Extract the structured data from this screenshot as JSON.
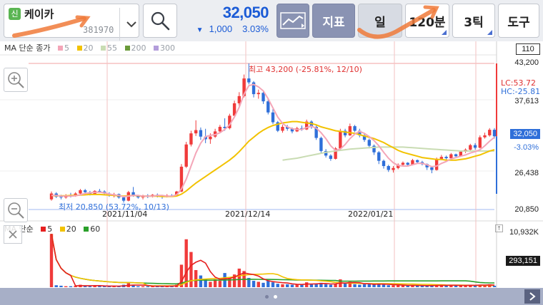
{
  "stock": {
    "badge": "신",
    "name": "케이카",
    "code": "381970"
  },
  "quote": {
    "price": "32,050",
    "direction": "▼",
    "change": "1,000",
    "change_pct": "3.03%"
  },
  "toolbar": {
    "indicator_label": "지표",
    "period_day_label": "일",
    "period_min_label": "120분",
    "tick_label": "3틱",
    "tools_label": "도구"
  },
  "legend_top": {
    "title": "MA 단순 종가",
    "items": [
      {
        "label": "5",
        "color": "#f4a6b8"
      },
      {
        "label": "20",
        "color": "#f2c200"
      },
      {
        "label": "55",
        "color": "#c9dcb3"
      },
      {
        "label": "200",
        "color": "#6a9a3a"
      },
      {
        "label": "300",
        "color": "#b39ddb"
      }
    ]
  },
  "legend_bottom": {
    "title": "MA 단순",
    "items": [
      {
        "label": "5",
        "color": "#e62020"
      },
      {
        "label": "20",
        "color": "#f2c200"
      },
      {
        "label": "60",
        "color": "#2aa02a"
      }
    ]
  },
  "annotations": {
    "high": "최고 43,200 (-25.81%, 12/10)",
    "low": "최저 20,850 (53.72%, 10/13)",
    "lc": "LC:53.72",
    "hc": "HC:-25.81"
  },
  "price_axis": {
    "top_box": "110",
    "labels": [
      "43,200",
      "37,613",
      "26,438",
      "20,850"
    ],
    "current": "32,050",
    "current_pct": "-3.03%"
  },
  "volume_axis": {
    "max": "10,932K",
    "current": "293,151"
  },
  "x_labels": [
    "2021/11/04",
    "2021/12/14",
    "2022/01/21"
  ],
  "colors": {
    "up": "#f03a3a",
    "down": "#2f6fd9",
    "price_blue": "#1b5bd6"
  },
  "chart_data": {
    "type": "candlestick",
    "ylim": [
      20850,
      43200
    ],
    "candles": [
      [
        22400,
        23600,
        22200,
        23300
      ],
      [
        23300,
        23500,
        22600,
        22800
      ],
      [
        22800,
        23100,
        22400,
        22700
      ],
      [
        22700,
        23200,
        22500,
        23000
      ],
      [
        23000,
        23400,
        22700,
        22900
      ],
      [
        22900,
        23500,
        22800,
        23300
      ],
      [
        23300,
        24000,
        23200,
        23800
      ],
      [
        23800,
        24000,
        23300,
        23500
      ],
      [
        23500,
        23700,
        23000,
        23200
      ],
      [
        23200,
        23800,
        23100,
        23700
      ],
      [
        23700,
        24000,
        23400,
        23600
      ],
      [
        23600,
        23800,
        23100,
        23300
      ],
      [
        23300,
        23500,
        22800,
        23000
      ],
      [
        23000,
        23400,
        22700,
        23200
      ],
      [
        23200,
        23300,
        22500,
        22700
      ],
      [
        22700,
        22900,
        21900,
        22200
      ],
      [
        22200,
        23700,
        22100,
        23500
      ],
      [
        23500,
        24300,
        22800,
        23000
      ],
      [
        23000,
        23100,
        22500,
        22700
      ],
      [
        22700,
        23100,
        22400,
        23000
      ],
      [
        23000,
        23200,
        22600,
        22800
      ],
      [
        22800,
        23200,
        22700,
        23100
      ],
      [
        23100,
        23300,
        22700,
        22900
      ],
      [
        22900,
        23100,
        22500,
        22800
      ],
      [
        22800,
        23200,
        22700,
        23000
      ],
      [
        23000,
        23200,
        22800,
        22900
      ],
      [
        22900,
        23700,
        22900,
        23600
      ],
      [
        23600,
        27800,
        23500,
        27400
      ],
      [
        27400,
        31200,
        27200,
        30800
      ],
      [
        30800,
        32900,
        30500,
        32500
      ],
      [
        32500,
        34500,
        32100,
        33000
      ],
      [
        33000,
        33400,
        31500,
        32000
      ],
      [
        32000,
        33200,
        31000,
        31600
      ],
      [
        31600,
        32500,
        30900,
        32000
      ],
      [
        32000,
        33200,
        31800,
        32800
      ],
      [
        32800,
        33800,
        32600,
        33500
      ],
      [
        33500,
        34800,
        32900,
        33300
      ],
      [
        33300,
        35500,
        33100,
        35200
      ],
      [
        35200,
        37500,
        35000,
        37100
      ],
      [
        37100,
        38800,
        36500,
        38200
      ],
      [
        38200,
        41500,
        38000,
        40900
      ],
      [
        40900,
        43200,
        40000,
        40300
      ],
      [
        40300,
        40500,
        38000,
        38500
      ],
      [
        38500,
        39200,
        37800,
        38700
      ],
      [
        38700,
        38900,
        37000,
        37400
      ],
      [
        37400,
        37800,
        35400,
        35700
      ],
      [
        35700,
        36200,
        33900,
        34200
      ],
      [
        34200,
        34400,
        32700,
        32900
      ],
      [
        32900,
        33800,
        32600,
        33500
      ],
      [
        33500,
        33800,
        32900,
        33200
      ],
      [
        33200,
        33400,
        32500,
        32800
      ],
      [
        32800,
        33500,
        32700,
        33300
      ],
      [
        33300,
        33700,
        32900,
        33100
      ],
      [
        33100,
        34600,
        33000,
        34300
      ],
      [
        34300,
        34500,
        33200,
        33500
      ],
      [
        33500,
        33700,
        31500,
        31800
      ],
      [
        31800,
        32000,
        29500,
        29800
      ],
      [
        29800,
        30100,
        28800,
        29100
      ],
      [
        29100,
        29300,
        28300,
        28600
      ],
      [
        28600,
        30400,
        28500,
        30200
      ],
      [
        30200,
        33200,
        30100,
        32900
      ],
      [
        32900,
        33200,
        31900,
        32200
      ],
      [
        32200,
        34000,
        32100,
        33600
      ],
      [
        33600,
        33800,
        32700,
        32900
      ],
      [
        32900,
        33200,
        31900,
        32200
      ],
      [
        32200,
        32400,
        31200,
        31500
      ],
      [
        31500,
        31700,
        30200,
        30600
      ],
      [
        30600,
        30800,
        29200,
        29600
      ],
      [
        29600,
        29800,
        27800,
        28300
      ],
      [
        28300,
        28500,
        27100,
        27500
      ],
      [
        27500,
        27700,
        26600,
        26900
      ],
      [
        26900,
        27500,
        26500,
        27200
      ],
      [
        27200,
        27900,
        27000,
        27700
      ],
      [
        27700,
        28200,
        27500,
        28000
      ],
      [
        28000,
        28100,
        27400,
        27700
      ],
      [
        27700,
        28600,
        27600,
        28400
      ],
      [
        28400,
        28500,
        27900,
        28100
      ],
      [
        28100,
        28300,
        27600,
        27800
      ],
      [
        27800,
        27900,
        26900,
        27300
      ],
      [
        27300,
        27500,
        26400,
        26900
      ],
      [
        26900,
        28800,
        26800,
        28600
      ],
      [
        28600,
        29200,
        28400,
        28900
      ],
      [
        28900,
        29100,
        28500,
        28700
      ],
      [
        28700,
        29500,
        28500,
        29300
      ],
      [
        29300,
        29400,
        28800,
        29000
      ],
      [
        29000,
        29800,
        28900,
        29700
      ],
      [
        29700,
        30200,
        29500,
        30000
      ],
      [
        30000,
        30900,
        29900,
        30700
      ],
      [
        30700,
        31000,
        30000,
        30300
      ],
      [
        30300,
        32200,
        30200,
        31900
      ],
      [
        31900,
        32600,
        31700,
        32200
      ],
      [
        32200,
        33300,
        32000,
        33050
      ],
      [
        33050,
        33300,
        31700,
        32050
      ]
    ],
    "ma20": [
      23000,
      22950,
      22950,
      22950,
      23000,
      23000,
      23050,
      23100,
      23150,
      23150,
      23150,
      23100,
      23050,
      23000,
      22950,
      22900,
      22950,
      23000,
      22950,
      22900,
      22900,
      22900,
      22900,
      22850,
      22850,
      22850,
      22900,
      23200,
      23700,
      24300,
      24900,
      25400,
      25900,
      26400,
      26900,
      27400,
      27900,
      28400,
      29000,
      29700,
      30500,
      31300,
      31900,
      32500,
      33000,
      33400,
      33700,
      33900,
      34100,
      34200,
      34300,
      34300,
      34200,
      34100,
      34000,
      33800,
      33500,
      33300,
      33100,
      32900,
      32800,
      32700,
      32600,
      32500,
      32300,
      32100,
      31900,
      31700,
      31400,
      31100,
      30700,
      30300,
      29900,
      29600,
      29400,
      29200,
      29000,
      28800,
      28700,
      28600,
      28500,
      28500,
      28400,
      28400,
      28400,
      28500,
      28600,
      28800,
      29000,
      29200,
      29500,
      29800,
      30000
    ],
    "ma5": [
      23000,
      23000,
      22900,
      22900,
      22900,
      22950,
      23100,
      23300,
      23400,
      23500,
      23500,
      23400,
      23200,
      23100,
      23000,
      22800,
      22900,
      23000,
      23000,
      22900,
      22900,
      22900,
      23000,
      23000,
      22900,
      22900,
      23100,
      24000,
      25500,
      27500,
      29500,
      31000,
      32000,
      32200,
      32300,
      32600,
      33100,
      33800,
      35000,
      36500,
      38500,
      39800,
      40000,
      39600,
      39000,
      37800,
      36400,
      35000,
      34000,
      33500,
      33200,
      33100,
      33100,
      33400,
      33600,
      33300,
      32600,
      31700,
      30600,
      29900,
      30100,
      30800,
      31700,
      32400,
      32800,
      32500,
      32000,
      31400,
      30600,
      29600,
      28700,
      28000,
      27600,
      27500,
      27500,
      27700,
      27900,
      27900,
      27700,
      27400,
      27500,
      27900,
      28200,
      28600,
      28800,
      29000,
      29200,
      29500,
      29700,
      30000,
      30600,
      31300,
      31900
    ],
    "ma55_start": 48,
    "ma55": [
      28400,
      28500,
      28600,
      28700,
      28850,
      29000,
      29150,
      29300,
      29450,
      29600,
      29700,
      29800,
      29900,
      30000,
      30100,
      30150,
      30200,
      30250,
      30300,
      30350,
      30400,
      30400,
      30400,
      30400,
      30400,
      30400,
      30350,
      30300,
      30250,
      30200,
      30150,
      30100,
      30050,
      30000,
      29950,
      29900,
      29850,
      29800,
      29800,
      29800,
      29800,
      29800,
      29800,
      29800,
      29800
    ],
    "volumes": [
      10.9,
      0.4,
      0.3,
      0.2,
      0.2,
      0.3,
      0.5,
      0.3,
      0.2,
      0.3,
      0.3,
      0.2,
      0.2,
      0.2,
      0.2,
      0.5,
      0.8,
      0.4,
      0.2,
      0.2,
      0.2,
      0.2,
      0.2,
      0.2,
      0.2,
      0.2,
      0.5,
      4.6,
      9.8,
      7.2,
      3.5,
      2.4,
      1.7,
      1.1,
      1.6,
      1.3,
      2.9,
      2.0,
      2.6,
      3.8,
      3.3,
      1.9,
      1.3,
      1.1,
      0.9,
      1.4,
      1.0,
      0.7,
      0.6,
      0.6,
      0.5,
      0.6,
      0.5,
      1.0,
      0.6,
      0.7,
      0.9,
      0.6,
      0.5,
      0.7,
      1.6,
      0.8,
      1.1,
      0.6,
      0.5,
      0.6,
      0.7,
      0.6,
      0.7,
      0.5,
      0.4,
      0.4,
      0.4,
      0.4,
      0.3,
      0.4,
      0.3,
      0.3,
      0.3,
      0.3,
      0.6,
      0.4,
      0.3,
      0.4,
      0.3,
      0.4,
      0.4,
      0.5,
      0.3,
      0.5,
      0.4,
      0.6,
      0.3
    ]
  }
}
